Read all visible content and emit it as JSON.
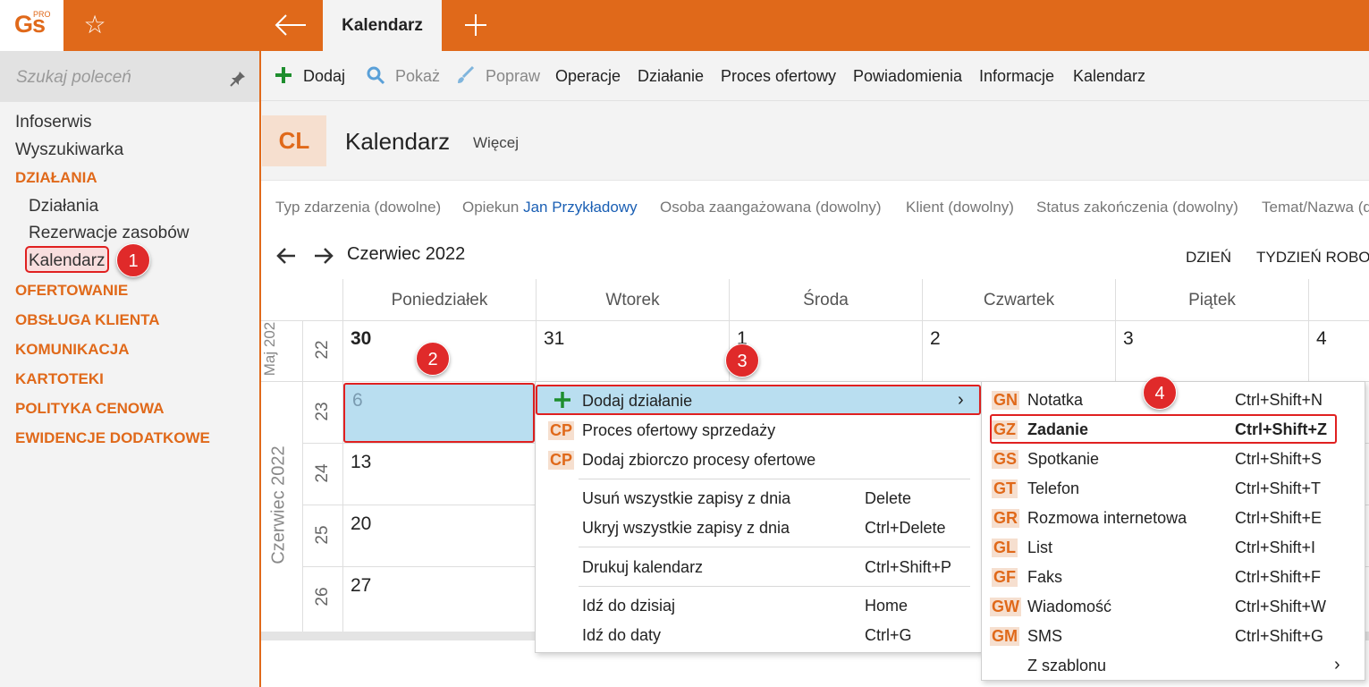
{
  "topbar": {
    "logo_text": "Gs",
    "logo_sup": "PRO",
    "active_tab": "Kalendarz"
  },
  "sidebar": {
    "search_placeholder": "Szukaj poleceń",
    "items_top": [
      "Infoserwis",
      "Wyszukiwarka"
    ],
    "section_active": "DZIAŁANIA",
    "sub_items": [
      "Działania",
      "Rezerwacje zasobów",
      "Kalendarz"
    ],
    "categories": [
      "OFERTOWANIE",
      "OBSŁUGA KLIENTA",
      "KOMUNIKACJA",
      "KARTOTEKI",
      "POLITYKA CENOWA",
      "EWIDENCJE DODATKOWE"
    ]
  },
  "toolbar": {
    "add": "Dodaj",
    "show": "Pokaż",
    "edit": "Popraw",
    "operations": "Operacje",
    "action": "Działanie",
    "offer_process": "Proces ofertowy",
    "notifications": "Powiadomienia",
    "information": "Informacje",
    "calendar": "Kalendarz"
  },
  "header": {
    "badge": "CL",
    "title": "Kalendarz",
    "more": "Więcej"
  },
  "filters": {
    "event_type": "Typ zdarzenia (dowolne)",
    "owner_label": "Opiekun",
    "owner_value": "Jan Przykładowy",
    "involved": "Osoba zaangażowana (dowolny)",
    "client": "Klient (dowolny)",
    "status": "Status zakończenia (dowolny)",
    "topic": "Temat/Nazwa (d"
  },
  "calendar": {
    "month": "Czerwiec 2022",
    "view_day": "DZIEŃ",
    "view_work_week": "TYDZIEŃ ROBOC",
    "day_names": [
      "Poniedziałek",
      "Wtorek",
      "Środa",
      "Czwartek",
      "Piątek"
    ],
    "month_side_top": "Maj 202",
    "month_side_main": "Czerwiec 2022",
    "weeks": [
      {
        "num": "22",
        "days": [
          "30",
          "31",
          "1",
          "2",
          "3",
          "4"
        ]
      },
      {
        "num": "23",
        "days": [
          "6"
        ]
      },
      {
        "num": "24",
        "days": [
          "13"
        ]
      },
      {
        "num": "25",
        "days": [
          "20"
        ]
      },
      {
        "num": "26",
        "days": [
          "27"
        ]
      }
    ]
  },
  "context_menu": {
    "items": [
      {
        "label": "Dodaj działanie"
      },
      {
        "code": "CP",
        "label": "Proces ofertowy sprzedaży"
      },
      {
        "code": "CP",
        "label": "Dodaj zbiorczo procesy ofertowe"
      },
      {
        "label": "Usuń wszystkie zapisy z dnia",
        "shortcut": "Delete"
      },
      {
        "label": "Ukryj wszystkie zapisy z dnia",
        "shortcut": "Ctrl+Delete"
      },
      {
        "label": "Drukuj kalendarz",
        "shortcut": "Ctrl+Shift+P"
      },
      {
        "label": "Idź do dzisiaj",
        "shortcut": "Home"
      },
      {
        "label": "Idź do daty",
        "shortcut": "Ctrl+G"
      }
    ]
  },
  "submenu": {
    "items": [
      {
        "code": "GN",
        "label": "Notatka",
        "shortcut": "Ctrl+Shift+N"
      },
      {
        "code": "GZ",
        "label": "Zadanie",
        "shortcut": "Ctrl+Shift+Z"
      },
      {
        "code": "GS",
        "label": "Spotkanie",
        "shortcut": "Ctrl+Shift+S"
      },
      {
        "code": "GT",
        "label": "Telefon",
        "shortcut": "Ctrl+Shift+T"
      },
      {
        "code": "GR",
        "label": "Rozmowa internetowa",
        "shortcut": "Ctrl+Shift+E"
      },
      {
        "code": "GL",
        "label": "List",
        "shortcut": "Ctrl+Shift+I"
      },
      {
        "code": "GF",
        "label": "Faks",
        "shortcut": "Ctrl+Shift+F"
      },
      {
        "code": "GW",
        "label": "Wiadomość",
        "shortcut": "Ctrl+Shift+W"
      },
      {
        "code": "GM",
        "label": "SMS",
        "shortcut": "Ctrl+Shift+G"
      },
      {
        "label": "Z szablonu"
      }
    ]
  },
  "callouts": [
    "1",
    "2",
    "3",
    "4"
  ],
  "colors": {
    "accent": "#e0691a",
    "highlight_border": "#e02020",
    "selection": "#b9def0",
    "add_icon": "#1e8e2e"
  }
}
